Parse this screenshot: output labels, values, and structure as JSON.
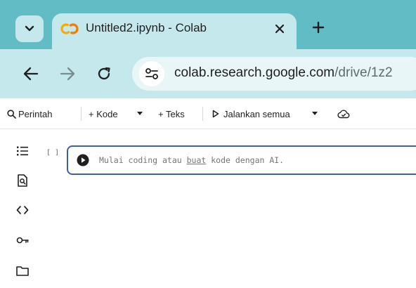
{
  "browser": {
    "tab": {
      "title": "Untitled2.ipynb - Colab",
      "logo": "colab-logo"
    },
    "url": {
      "domain": "colab.research.google.com",
      "path": "/drive/1z2"
    },
    "icons": {
      "tab_menu": "chevron-down-icon",
      "close": "close-icon",
      "new_tab": "plus-icon",
      "back": "arrow-left-icon",
      "forward": "arrow-right-icon",
      "reload": "reload-icon",
      "site_info": "tune-icon"
    }
  },
  "colab_toolbar": {
    "search_label": "Perintah",
    "add_code_label": "+ Kode",
    "add_text_label": "+ Teks",
    "run_all_label": "Jalankan semua"
  },
  "rail": [
    "table-of-contents-icon",
    "find-icon",
    "code-icon",
    "key-icon",
    "folder-icon"
  ],
  "cell": {
    "counter": "[ ]",
    "placeholder_before": "Mulai coding atau ",
    "placeholder_link": "buat",
    "placeholder_after": " kode dengan AI."
  },
  "colors": {
    "tabstrip": "#61bcc6",
    "toolbar": "#c4e8ec",
    "cell_border": "#3b5fa8",
    "colab_orange": "#f9ab00"
  }
}
